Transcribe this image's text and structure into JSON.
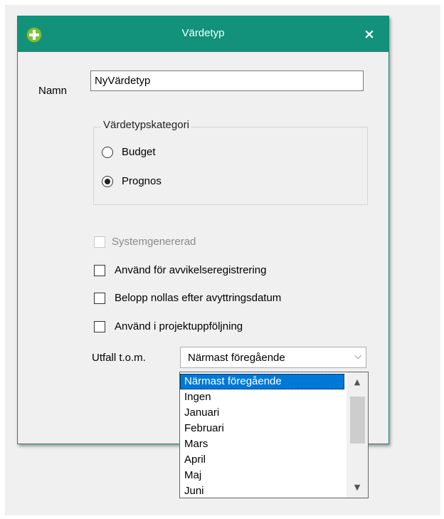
{
  "dialog": {
    "title": "Värdetyp",
    "icon": "plus-circle-icon",
    "close_label": "×"
  },
  "name_field": {
    "label": "Namn",
    "value": "NyVärdetyp"
  },
  "category": {
    "legend": "Värdetypskategori",
    "options": [
      {
        "label": "Budget",
        "checked": false
      },
      {
        "label": "Prognos",
        "checked": true
      }
    ]
  },
  "checkboxes": [
    {
      "label": "Systemgenererad",
      "checked": false,
      "disabled": true
    },
    {
      "label": "Använd för avvikelseregistrering",
      "checked": false,
      "disabled": false
    },
    {
      "label": "Belopp nollas efter avyttringsdatum",
      "checked": false,
      "disabled": false
    },
    {
      "label": "Använd i projektuppföljning",
      "checked": false,
      "disabled": false
    }
  ],
  "outcome": {
    "label": "Utfall t.o.m.",
    "selected": "Närmast föregående",
    "arrow": "⌵",
    "options": [
      "Närmast föregående",
      "Ingen",
      "Januari",
      "Februari",
      "Mars",
      "April",
      "Maj",
      "Juni"
    ]
  },
  "scrollbar": {
    "up": "▲",
    "down": "▼"
  },
  "colors": {
    "titlebar": "#12917b",
    "selection": "#0078d7"
  }
}
